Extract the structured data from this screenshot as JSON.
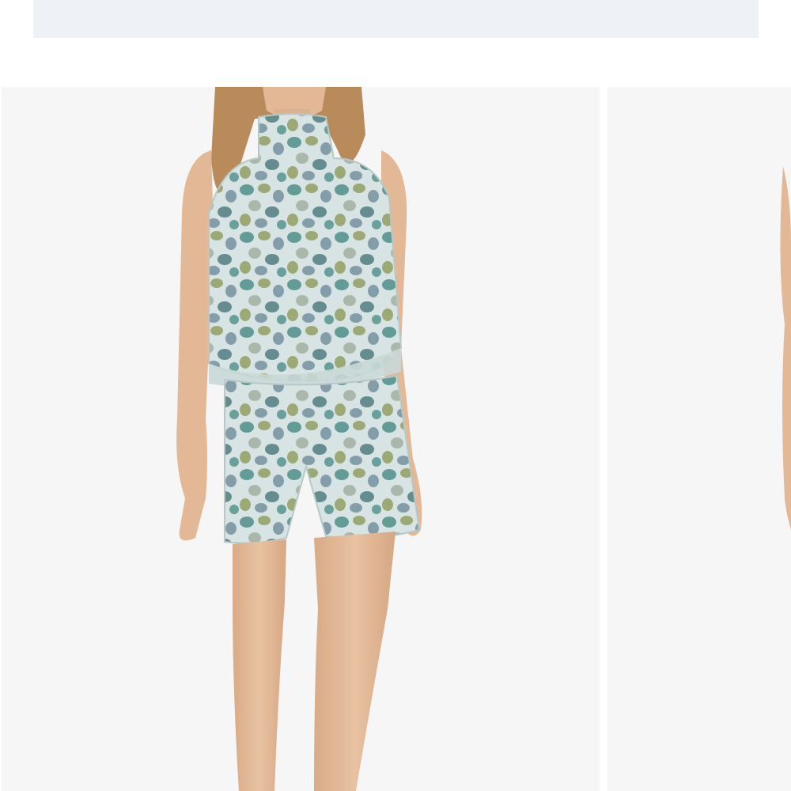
{
  "banner": {
    "color": "#eef2f6"
  },
  "gallery": {
    "images": [
      {
        "name": "romper-front",
        "background": "#f6f6f6",
        "skin": "#e2b896",
        "hair": "#b98a5a",
        "fabric_base": "#cfdedf",
        "spot_colors": [
          "#4f8f8a",
          "#8f9a5a",
          "#6f8c9b",
          "#a7b3a4",
          "#3f6f72"
        ]
      },
      {
        "name": "romper-next",
        "background": "#f6f6f6",
        "skin": "#e2b896"
      }
    ]
  }
}
